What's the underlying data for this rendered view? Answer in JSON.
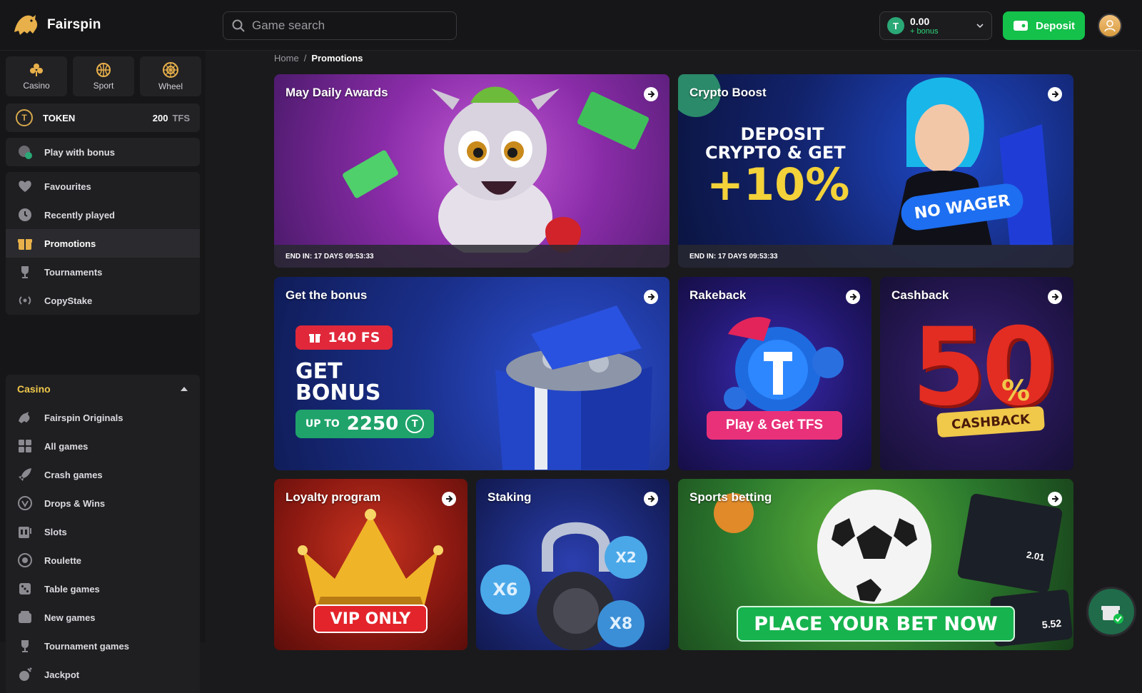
{
  "brand": {
    "name": "Fairspin"
  },
  "search": {
    "placeholder": "Game search"
  },
  "balance": {
    "amount": "0.00",
    "bonus_label": "+ bonus",
    "coin_symbol": "T"
  },
  "header": {
    "deposit_label": "Deposit"
  },
  "sidebar": {
    "tiles": [
      {
        "label": "Casino",
        "icon": "clover-icon"
      },
      {
        "label": "Sport",
        "icon": "basketball-icon"
      },
      {
        "label": "Wheel",
        "icon": "wheel-icon"
      }
    ],
    "token": {
      "label": "TOKEN",
      "value": "200",
      "unit": "TFS",
      "symbol": "T"
    },
    "play_with_bonus": "Play with bonus",
    "nav": [
      {
        "label": "Favourites",
        "icon": "heart-icon"
      },
      {
        "label": "Recently played",
        "icon": "clock-icon"
      },
      {
        "label": "Promotions",
        "icon": "gift-icon",
        "active": true
      },
      {
        "label": "Tournaments",
        "icon": "trophy-icon"
      },
      {
        "label": "CopyStake",
        "icon": "broadcast-icon"
      }
    ],
    "casino_section": {
      "title": "Casino",
      "items": [
        {
          "label": "Fairspin Originals",
          "icon": "lion-icon"
        },
        {
          "label": "All games",
          "icon": "grid-icon"
        },
        {
          "label": "Crash games",
          "icon": "rocket-icon"
        },
        {
          "label": "Drops & Wins",
          "icon": "drop-icon"
        },
        {
          "label": "Slots",
          "icon": "slot-icon"
        },
        {
          "label": "Roulette",
          "icon": "roulette-icon"
        },
        {
          "label": "Table games",
          "icon": "dice-icon"
        },
        {
          "label": "New games",
          "icon": "new-icon"
        },
        {
          "label": "Tournament games",
          "icon": "trophy-icon"
        },
        {
          "label": "Jackpot",
          "icon": "jackpot-icon"
        }
      ]
    }
  },
  "breadcrumb": {
    "home": "Home",
    "separator": "/",
    "current": "Promotions"
  },
  "promotions": {
    "may_daily": {
      "title": "May Daily Awards",
      "footer": "END IN: 17 DAYS 09:53:33"
    },
    "crypto_boost": {
      "title": "Crypto Boost",
      "line1": "DEPOSIT",
      "line2": "CRYPTO & GET",
      "percent": "+10%",
      "badge": "NO WAGER",
      "footer": "END IN: 17 DAYS 09:53:33"
    },
    "get_bonus": {
      "title": "Get the bonus",
      "fs_badge": "140 FS",
      "line1": "GET",
      "line2": "BONUS",
      "upto_label": "UP TO",
      "upto_value": "2250"
    },
    "rakeback": {
      "title": "Rakeback",
      "cta": "Play & Get TFS"
    },
    "cashback": {
      "title": "Cashback",
      "number": "50",
      "percent_sign": "%",
      "ribbon": "CASHBACK"
    },
    "loyalty": {
      "title": "Loyalty program",
      "badge": "VIP ONLY"
    },
    "staking": {
      "title": "Staking",
      "coin1": "X6",
      "coin2": "X2",
      "coin3": "X8"
    },
    "sports": {
      "title": "Sports betting",
      "cta": "PLACE YOUR BET NOW",
      "odds": [
        "2.01",
        "5.52"
      ]
    }
  },
  "colors": {
    "accent_green": "#14c14a",
    "casino_header": "#f0c84a",
    "bg": "#1a1a1c"
  }
}
